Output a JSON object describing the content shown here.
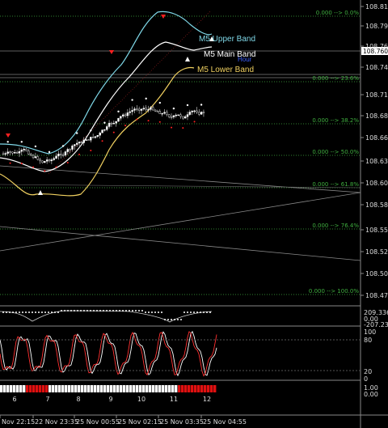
{
  "colors": {
    "bg": "#000000",
    "grid": "#3a3a3a",
    "axis_text": "#dddddd",
    "upper_band": "#7fd8e8",
    "main_band": "#ffffff",
    "lower_band": "#f0d060",
    "fib": "#3fae3f",
    "red_mark": "#ff2020",
    "white_mark": "#ffffff",
    "oscillator": "#ff3030",
    "oscillator_signal": "#ffffff",
    "heat_on": "#e01010",
    "heat_off": "#ffffff"
  },
  "price_axis": {
    "ticks": [
      "108.815",
      "108.790",
      "108.765",
      "108.740",
      "108.710",
      "108.685",
      "108.660",
      "108.630",
      "108.605",
      "108.580",
      "108.555",
      "108.525",
      "108.500",
      "108.475"
    ],
    "current_price": "108.760"
  },
  "bands": {
    "upper_label": "M5 Upper Band",
    "main_label": "M5 Main Band",
    "lower_label": "M5 Lower Band",
    "extra_label": "Hour"
  },
  "fib_levels": [
    {
      "label": "0.000 --> 0.0%"
    },
    {
      "label": "0.000 --> 23.6%"
    },
    {
      "label": "0.000 --> 38.2%"
    },
    {
      "label": "0.000 --> 50.0%"
    },
    {
      "label": "0.000 --> 61.8%"
    },
    {
      "label": "0.000 --> 76.4%"
    },
    {
      "label": "0.000 --> 100.0%"
    }
  ],
  "indicator1": {
    "ticks": [
      "209.3365",
      "0.00",
      "-207.234"
    ]
  },
  "indicator2": {
    "ticks": [
      "100",
      "80",
      "20",
      "0"
    ]
  },
  "indicator3": {
    "ticks": [
      "1.00",
      "0.00"
    ],
    "hour_labels": [
      "6",
      "7",
      "8",
      "9",
      "10",
      "11",
      "12"
    ]
  },
  "time_axis": [
    "Nov 22:15",
    "22 Nov 23:35",
    "25 Nov 00:55",
    "25 Nov 02:15",
    "25 Nov 03:35",
    "25 Nov 04:55"
  ]
}
